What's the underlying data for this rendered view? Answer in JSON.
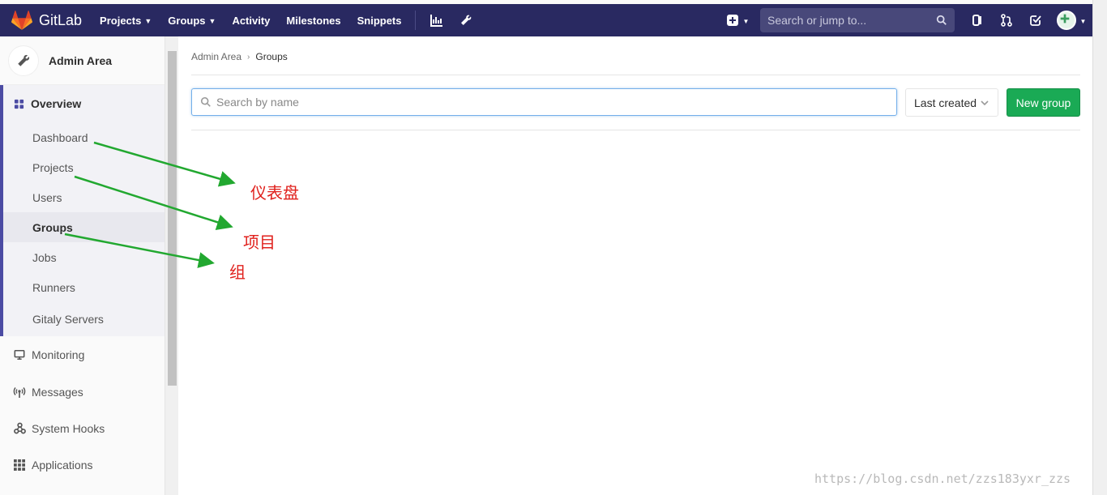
{
  "navbar": {
    "brand": "GitLab",
    "items": [
      {
        "label": "Projects",
        "caret": true
      },
      {
        "label": "Groups",
        "caret": true
      },
      {
        "label": "Activity",
        "caret": false
      },
      {
        "label": "Milestones",
        "caret": false
      },
      {
        "label": "Snippets",
        "caret": false
      }
    ],
    "search_placeholder": "Search or jump to...",
    "color": "#292961"
  },
  "sidebar": {
    "title": "Admin Area",
    "overview": {
      "label": "Overview",
      "items": [
        {
          "label": "Dashboard",
          "active": false
        },
        {
          "label": "Projects",
          "active": false
        },
        {
          "label": "Users",
          "active": false
        },
        {
          "label": "Groups",
          "active": true
        },
        {
          "label": "Jobs",
          "active": false
        },
        {
          "label": "Runners",
          "active": false
        },
        {
          "label": "Gitaly Servers",
          "active": false
        }
      ]
    },
    "sections": [
      {
        "label": "Monitoring",
        "icon": "monitor-icon"
      },
      {
        "label": "Messages",
        "icon": "broadcast-icon"
      },
      {
        "label": "System Hooks",
        "icon": "hook-icon"
      },
      {
        "label": "Applications",
        "icon": "grid-icon"
      }
    ]
  },
  "main": {
    "breadcrumb": [
      "Admin Area",
      "Groups"
    ],
    "filter_placeholder": "Search by name",
    "sort_label": "Last created",
    "new_group_label": "New group",
    "accent": "#1aaa55"
  },
  "annotations": [
    "仪表盘",
    "项目",
    "组"
  ],
  "watermark": "https://blog.csdn.net/zzs183yxr_zzs"
}
